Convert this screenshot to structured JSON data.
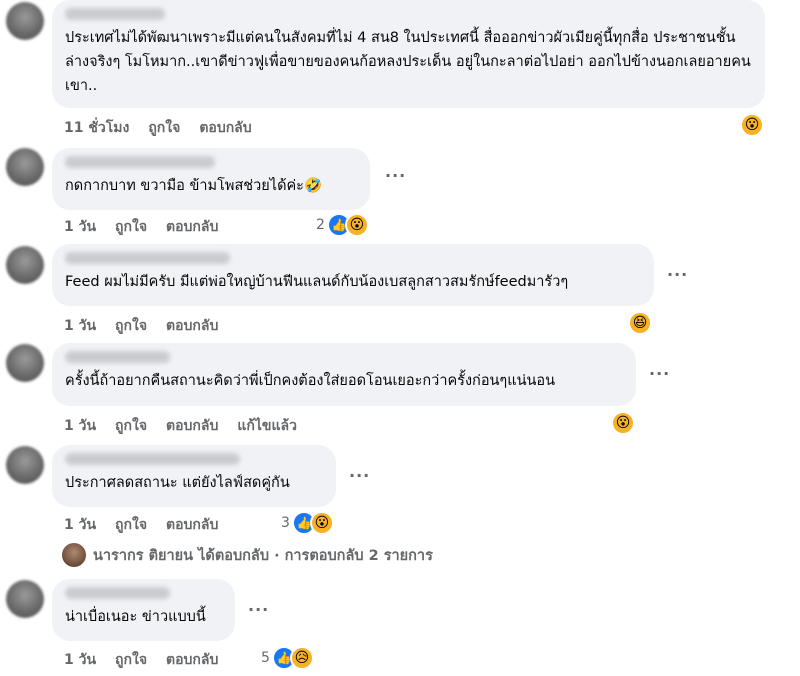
{
  "comments": [
    {
      "text": "ประเทศไม่ได้พัฒนาเพราะมีแต่คนในสังคมที่ไม่ 4 สน8 ในประเทศนี้ สื่อออกข่าวผัวเมียคู่นี้ทุกสื่อ ประชาชนชั้นล่างจริงๆ โมโหมาก..เขาดีข่าวฟูเพื่อขายของคนก้อหลงประเด็น อยู่ในกะลาต่อไปอย่า ออกไปข้างนอกเลยอายคนเขา..",
      "time": "11 ชั่วโมง",
      "like": "ถูกใจ",
      "reply": "ตอบกลับ",
      "reactions": [
        "wow"
      ]
    },
    {
      "text": "กดกากบาท ขวามือ ข้ามโพสช่วยได้ค่ะ🤣",
      "time": "1 วัน",
      "like": "ถูกใจ",
      "reply": "ตอบกลับ",
      "count": "2",
      "reactions": [
        "like",
        "wow"
      ]
    },
    {
      "text": "Feed ผมไม่มีครับ มีแต่พ่อใหญ่บ้านฟีนแลนด์กับน้องเบสลูกสาวสมรักษ์feedมารัวๆ",
      "time": "1 วัน",
      "like": "ถูกใจ",
      "reply": "ตอบกลับ",
      "reactions": [
        "haha"
      ]
    },
    {
      "text": "ครั้งนี้ถ้าอยากคืนสถานะคิดว่าพี่เป็กคงต้องใส่ยอดโอนเยอะกว่าครั้งก่อนๆแน่นอน",
      "time": "1 วัน",
      "like": "ถูกใจ",
      "reply": "ตอบกลับ",
      "edited": "แก้ไขแล้ว",
      "reactions": [
        "wow"
      ]
    },
    {
      "text": "ประกาศลดสถานะ แต่ยังไลฟ์สดคู่กัน",
      "time": "1 วัน",
      "like": "ถูกใจ",
      "reply": "ตอบกลับ",
      "count": "3",
      "reactions": [
        "like",
        "wow"
      ]
    },
    {
      "text": "น่าเบื่อเนอะ ข่าวแบบนี้",
      "time": "1 วัน",
      "like": "ถูกใจ",
      "reply": "ตอบกลับ",
      "count": "5",
      "reactions": [
        "like",
        "sad"
      ]
    }
  ],
  "reply_summary": "นารากร ติยายน ได้ตอบกลับ · การตอบกลับ 2 รายการ",
  "more_label": "···",
  "icons": {
    "like": "👍",
    "wow": "😮",
    "haha": "😆",
    "sad": "😥"
  }
}
